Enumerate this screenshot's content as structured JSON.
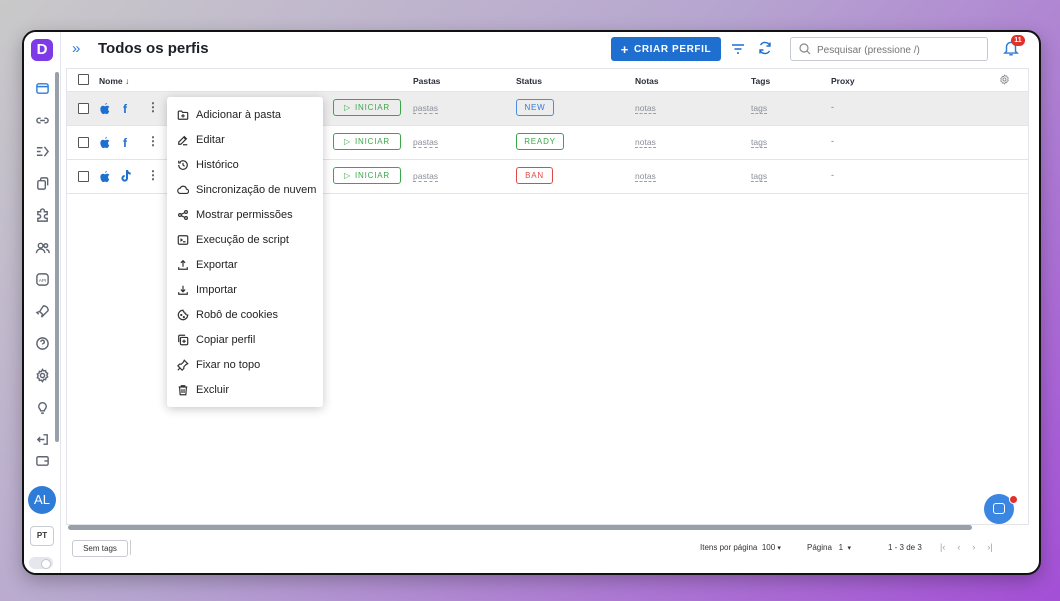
{
  "header": {
    "title": "Todos os perfis",
    "create_label": "CRIAR PERFIL",
    "search_placeholder": "Pesquisar (pressione /)",
    "notification_count": "11"
  },
  "sidebar": {
    "logo": "D",
    "avatar": "AL",
    "lang": "PT"
  },
  "table": {
    "columns": {
      "name": "Nome",
      "folders": "Pastas",
      "status": "Status",
      "notes": "Notas",
      "tags": "Tags",
      "proxy": "Proxy"
    },
    "rows": [
      {
        "platform": "facebook",
        "start": "INICIAR",
        "folders": "pastas",
        "status": "NEW",
        "notes": "notas",
        "tags": "tags",
        "proxy": "-"
      },
      {
        "platform": "facebook",
        "start": "INICIAR",
        "folders": "pastas",
        "status": "READY",
        "notes": "notas",
        "tags": "tags",
        "proxy": "-"
      },
      {
        "platform": "tiktok",
        "start": "INICIAR",
        "folders": "pastas",
        "status": "BAN",
        "notes": "notas",
        "tags": "tags",
        "proxy": "-"
      }
    ]
  },
  "menu": {
    "items": [
      {
        "label": "Adicionar à pasta",
        "icon": "folder-plus-icon"
      },
      {
        "label": "Editar",
        "icon": "edit-icon"
      },
      {
        "label": "Histórico",
        "icon": "history-icon"
      },
      {
        "label": "Sincronização de nuvem",
        "icon": "cloud-icon"
      },
      {
        "label": "Mostrar permissões",
        "icon": "share-icon"
      },
      {
        "label": "Execução de script",
        "icon": "terminal-icon"
      },
      {
        "label": "Exportar",
        "icon": "export-icon"
      },
      {
        "label": "Importar",
        "icon": "import-icon"
      },
      {
        "label": "Robô de cookies",
        "icon": "cookie-icon"
      },
      {
        "label": "Copiar perfil",
        "icon": "copy-icon"
      },
      {
        "label": "Fixar no topo",
        "icon": "pin-icon"
      },
      {
        "label": "Excluir",
        "icon": "trash-icon"
      }
    ]
  },
  "footer": {
    "tags_button": "Sem tags",
    "items_per_page_label": "Itens por página",
    "items_per_page": "100",
    "page_label": "Página",
    "page": "1",
    "range": "1 - 3 de 3"
  },
  "colors": {
    "accent": "#1f6fd1",
    "green": "#3aa64a",
    "red": "#e04a44",
    "brand": "#7d3ae6"
  }
}
